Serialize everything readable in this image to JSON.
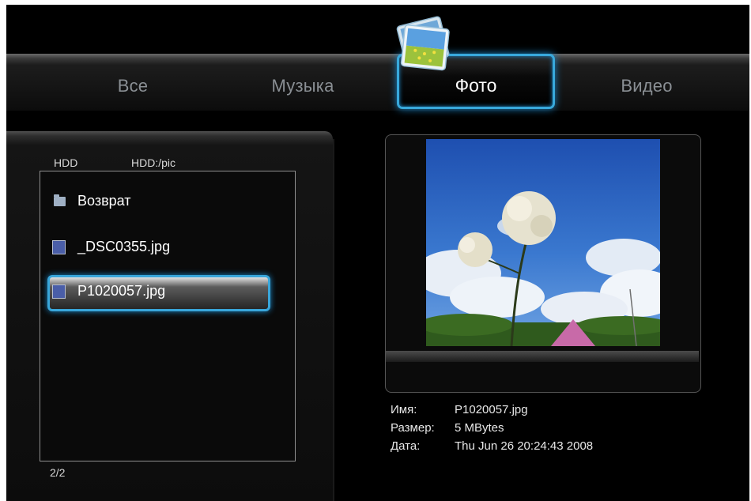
{
  "tabs": {
    "all": "Все",
    "music": "Музыка",
    "photo": "Фото",
    "video": "Видео",
    "selected": "photo"
  },
  "browser": {
    "device": "HDD",
    "path": "HDD:/pic",
    "items": [
      {
        "label": "Возврат",
        "icon": "folder-icon"
      },
      {
        "label": "_DSC0355.jpg",
        "icon": "image-file-icon"
      },
      {
        "label": "P1020057.jpg",
        "icon": "image-file-icon",
        "selected": true
      }
    ],
    "page_counter": "2/2"
  },
  "details": {
    "name_label": "Имя:",
    "name_value": "P1020057.jpg",
    "size_label": "Размер:",
    "size_value": "5 MBytes",
    "date_label": "Дата:",
    "date_value": "Thu Jun 26 20:24:43 2008"
  },
  "colors": {
    "accent": "#38a9dc",
    "background": "#000000",
    "text": "#ffffff",
    "inactive_tab": "#8a8f94"
  }
}
